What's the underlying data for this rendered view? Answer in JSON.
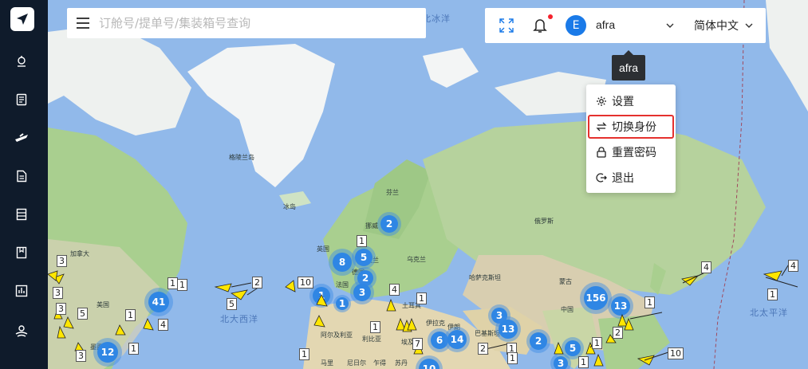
{
  "sidebar": {
    "items": [
      {
        "icon": "ship-wheel-icon"
      },
      {
        "icon": "order-list-icon"
      },
      {
        "icon": "plane-icon"
      },
      {
        "icon": "document-icon"
      },
      {
        "icon": "stack-icon"
      },
      {
        "icon": "bookmark-icon"
      },
      {
        "icon": "dashboard-icon"
      },
      {
        "icon": "cloud-icon"
      }
    ]
  },
  "search": {
    "placeholder": "订舱号/提单号/集装箱号查询"
  },
  "topbar": {
    "user_initial": "E",
    "username": "afra",
    "language": "简体中文"
  },
  "tooltip": "afra",
  "user_menu": {
    "items": [
      {
        "label": "设置",
        "icon": "gear-icon"
      },
      {
        "label": "切换身份",
        "icon": "switch-icon",
        "active": true
      },
      {
        "label": "重置密码",
        "icon": "lock-icon"
      },
      {
        "label": "退出",
        "icon": "logout-icon"
      }
    ]
  },
  "map": {
    "places": [
      "格陵兰岛",
      "冰岛",
      "芬兰",
      "挪威",
      "英国",
      "波兰",
      "乌克兰",
      "俄罗斯",
      "哈萨克斯坦",
      "蒙古",
      "中国",
      "加拿大",
      "美国",
      "墨西哥",
      "法国",
      "德国",
      "土耳其",
      "伊拉克",
      "伊朗",
      "巴基斯坦",
      "阿尔及利亚",
      "利比亚",
      "埃及",
      "马里",
      "尼日尔",
      "乍得",
      "苏丹"
    ],
    "oceans": [
      "北冰洋",
      "北大西洋",
      "北太平洋"
    ],
    "clusters": [
      "2",
      "8",
      "5",
      "1",
      "2",
      "3",
      "1",
      "41",
      "156",
      "13",
      "3",
      "13",
      "6",
      "14",
      "2",
      "5",
      "3",
      "12",
      "10"
    ],
    "ship_counts": [
      "1",
      "1",
      "10",
      "3",
      "2",
      "5",
      "3",
      "3",
      "5",
      "1",
      "4",
      "1",
      "3",
      "1",
      "4",
      "1",
      "1",
      "1",
      "7",
      "2",
      "1",
      "1",
      "1",
      "2",
      "4",
      "4",
      "1",
      "10",
      "1",
      "1"
    ]
  }
}
